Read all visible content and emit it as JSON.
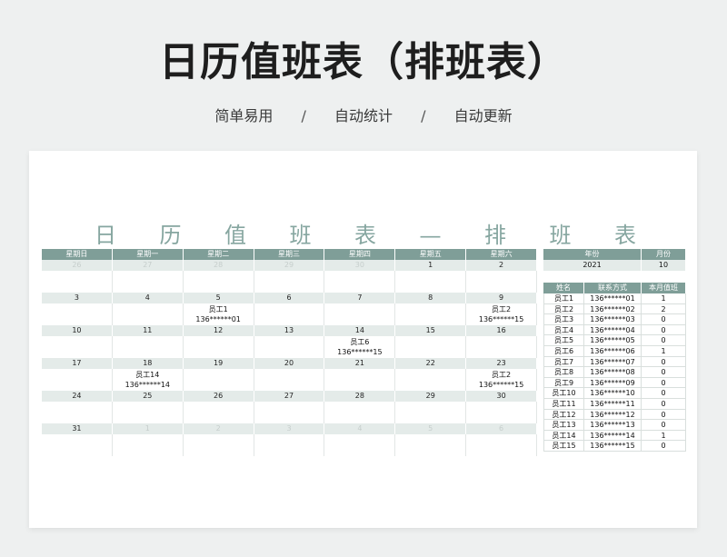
{
  "hero": {
    "title": "日历值班表（排班表）",
    "features": [
      "简单易用",
      "自动统计",
      "自动更新"
    ],
    "separator": "/"
  },
  "sheet_title_chars": [
    "日",
    "历",
    "值",
    "班",
    "表",
    "—",
    "排",
    "班",
    "表"
  ],
  "calendar": {
    "weekdays": [
      "星期日",
      "星期一",
      "星期二",
      "星期三",
      "星期四",
      "星期五",
      "星期六"
    ],
    "weeks": [
      [
        {
          "day": "26",
          "other": true,
          "name": "",
          "phone": ""
        },
        {
          "day": "27",
          "other": true,
          "name": "",
          "phone": ""
        },
        {
          "day": "28",
          "other": true,
          "name": "",
          "phone": ""
        },
        {
          "day": "29",
          "other": true,
          "name": "",
          "phone": ""
        },
        {
          "day": "30",
          "other": true,
          "name": "",
          "phone": ""
        },
        {
          "day": "1",
          "other": false,
          "name": "",
          "phone": ""
        },
        {
          "day": "2",
          "other": false,
          "name": "",
          "phone": ""
        }
      ],
      [
        {
          "day": "3",
          "other": false,
          "name": "",
          "phone": ""
        },
        {
          "day": "4",
          "other": false,
          "name": "",
          "phone": ""
        },
        {
          "day": "5",
          "other": false,
          "name": "员工1",
          "phone": "136******01"
        },
        {
          "day": "6",
          "other": false,
          "name": "",
          "phone": ""
        },
        {
          "day": "7",
          "other": false,
          "name": "",
          "phone": ""
        },
        {
          "day": "8",
          "other": false,
          "name": "",
          "phone": ""
        },
        {
          "day": "9",
          "other": false,
          "name": "员工2",
          "phone": "136******15"
        }
      ],
      [
        {
          "day": "10",
          "other": false,
          "name": "",
          "phone": ""
        },
        {
          "day": "11",
          "other": false,
          "name": "",
          "phone": ""
        },
        {
          "day": "12",
          "other": false,
          "name": "",
          "phone": ""
        },
        {
          "day": "13",
          "other": false,
          "name": "",
          "phone": ""
        },
        {
          "day": "14",
          "other": false,
          "name": "员工6",
          "phone": "136******15"
        },
        {
          "day": "15",
          "other": false,
          "name": "",
          "phone": ""
        },
        {
          "day": "16",
          "other": false,
          "name": "",
          "phone": ""
        }
      ],
      [
        {
          "day": "17",
          "other": false,
          "name": "",
          "phone": ""
        },
        {
          "day": "18",
          "other": false,
          "name": "员工14",
          "phone": "136******14"
        },
        {
          "day": "19",
          "other": false,
          "name": "",
          "phone": ""
        },
        {
          "day": "20",
          "other": false,
          "name": "",
          "phone": ""
        },
        {
          "day": "21",
          "other": false,
          "name": "",
          "phone": ""
        },
        {
          "day": "22",
          "other": false,
          "name": "",
          "phone": ""
        },
        {
          "day": "23",
          "other": false,
          "name": "员工2",
          "phone": "136******15"
        }
      ],
      [
        {
          "day": "24",
          "other": false,
          "name": "",
          "phone": ""
        },
        {
          "day": "25",
          "other": false,
          "name": "",
          "phone": ""
        },
        {
          "day": "26",
          "other": false,
          "name": "",
          "phone": ""
        },
        {
          "day": "27",
          "other": false,
          "name": "",
          "phone": ""
        },
        {
          "day": "28",
          "other": false,
          "name": "",
          "phone": ""
        },
        {
          "day": "29",
          "other": false,
          "name": "",
          "phone": ""
        },
        {
          "day": "30",
          "other": false,
          "name": "",
          "phone": ""
        }
      ],
      [
        {
          "day": "31",
          "other": false,
          "name": "",
          "phone": ""
        },
        {
          "day": "1",
          "other": true,
          "name": "",
          "phone": ""
        },
        {
          "day": "2",
          "other": true,
          "name": "",
          "phone": ""
        },
        {
          "day": "3",
          "other": true,
          "name": "",
          "phone": ""
        },
        {
          "day": "4",
          "other": true,
          "name": "",
          "phone": ""
        },
        {
          "day": "5",
          "other": true,
          "name": "",
          "phone": ""
        },
        {
          "day": "6",
          "other": true,
          "name": "",
          "phone": ""
        }
      ]
    ]
  },
  "year_month": {
    "year_label": "年份",
    "month_label": "月份",
    "year": "2021",
    "month": "10"
  },
  "staff": {
    "headers": [
      "姓名",
      "联系方式",
      "本月值班"
    ],
    "rows": [
      [
        "员工1",
        "136******01",
        "1"
      ],
      [
        "员工2",
        "136******02",
        "2"
      ],
      [
        "员工3",
        "136******03",
        "0"
      ],
      [
        "员工4",
        "136******04",
        "0"
      ],
      [
        "员工5",
        "136******05",
        "0"
      ],
      [
        "员工6",
        "136******06",
        "1"
      ],
      [
        "员工7",
        "136******07",
        "0"
      ],
      [
        "员工8",
        "136******08",
        "0"
      ],
      [
        "员工9",
        "136******09",
        "0"
      ],
      [
        "员工10",
        "136******10",
        "0"
      ],
      [
        "员工11",
        "136******11",
        "0"
      ],
      [
        "员工12",
        "136******12",
        "0"
      ],
      [
        "员工13",
        "136******13",
        "0"
      ],
      [
        "员工14",
        "136******14",
        "1"
      ],
      [
        "员工15",
        "136******15",
        "0"
      ]
    ]
  },
  "colors": {
    "header_bg": "#7f9e98",
    "daynum_bg": "#e4ebe9",
    "title_color": "#86a6a0"
  }
}
